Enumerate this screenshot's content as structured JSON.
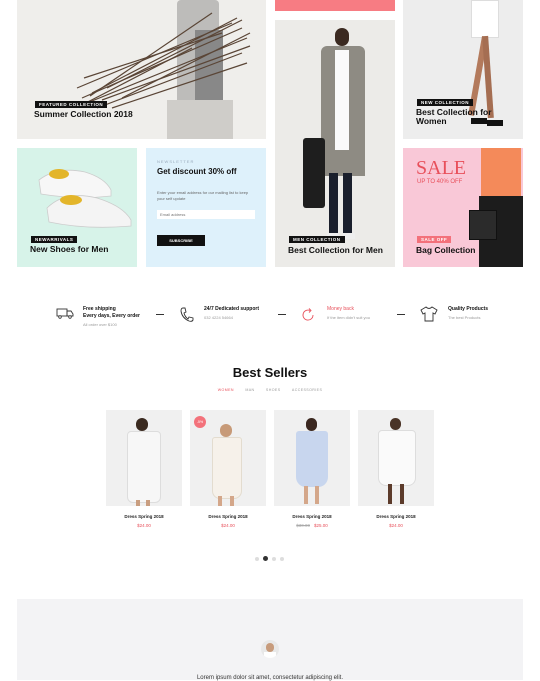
{
  "hero": {
    "featured_badge": "Featured Collection",
    "featured_title": "Summer Collection 2018",
    "women_badge": "New Collection",
    "women_title": "Best Collection for Women",
    "new_arrivals_badge": "Newarrivals",
    "new_arrivals_title": "New Shoes for Men",
    "newsletter_kicker": "Newsletter",
    "newsletter_title": "Get discount 30% off",
    "newsletter_text": "Enter your email address for our mailing list to keep your self update",
    "email_placeholder": "Email address",
    "subscribe_label": "Subscribe",
    "men_badge": "Men Collection",
    "men_title": "Best Collection for Men",
    "sale_big": "SALE",
    "sale_sub": "UP TO 40% OFF",
    "sale_badge": "Sale Off",
    "bag_title": "Bag Collection"
  },
  "features": [
    {
      "title": "Free shipping\nEvery days, Every order",
      "sub": "All order over $100",
      "icon": "truck-icon"
    },
    {
      "title": "24/7 Dedicated support",
      "sub": "032 4224 54664",
      "icon": "phone-icon"
    },
    {
      "title": "Money back",
      "sub": "If the item didn't suit you",
      "icon": "refresh-icon"
    },
    {
      "title": "Quality Products",
      "sub": "The best Products",
      "icon": "shirt-icon"
    }
  ],
  "bestsellers": {
    "title": "Best Sellers",
    "tabs": [
      "WOMEN",
      "MAN",
      "SHOES",
      "ACCESSORIES"
    ],
    "products": [
      {
        "name": "Dress Spring 2018",
        "price": "$24.00",
        "old_price": "",
        "badge": ""
      },
      {
        "name": "Dress Spring 2018",
        "price": "$24.00",
        "old_price": "",
        "badge": "-5%"
      },
      {
        "name": "Dress Spring 2018",
        "price": "$25.00",
        "old_price": "$30.00",
        "badge": ""
      },
      {
        "name": "Dress Spring 2018",
        "price": "$24.00",
        "old_price": "",
        "badge": ""
      }
    ],
    "active_dot": 2
  },
  "testimonial": {
    "text": "Lorem ipsum dolor sit amet, consectetur adipiscing elit."
  },
  "colors": {
    "accent": "#e8505b",
    "mint": "#d9f3ea",
    "light_blue": "#def1fb",
    "pink": "#f7c4d4",
    "coral": "#f7717b"
  }
}
